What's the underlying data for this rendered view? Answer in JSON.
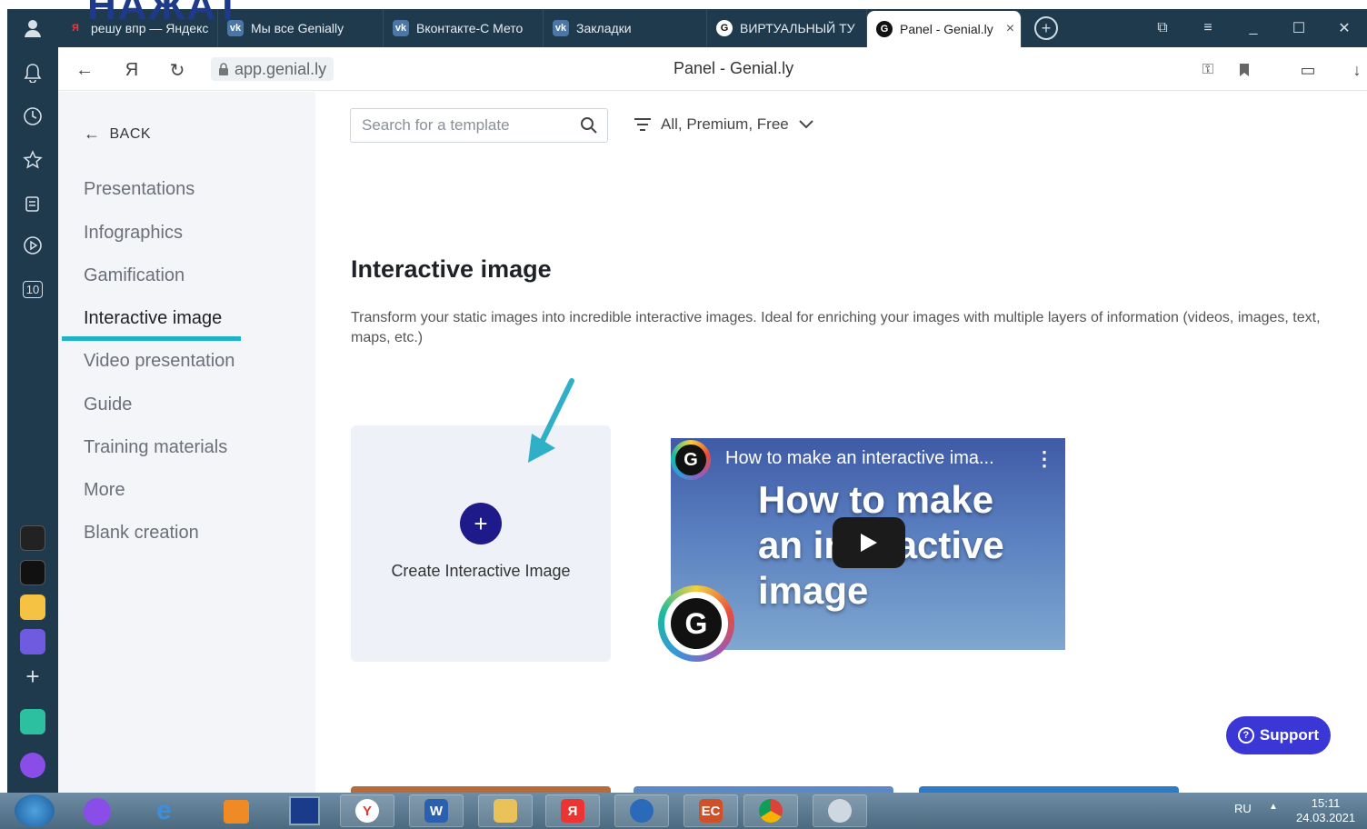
{
  "overlay": {
    "text": "НАЖАТ"
  },
  "tabs": [
    {
      "label": "решу впр — Яндекс",
      "favicon": "Я",
      "color": "#ff3333"
    },
    {
      "label": "Мы все Genially",
      "favicon": "vk",
      "color": "#4a76a8"
    },
    {
      "label": "Вконтакте-С Мето",
      "favicon": "vk",
      "color": "#4a76a8"
    },
    {
      "label": "Закладки",
      "favicon": "vk",
      "color": "#4a76a8"
    },
    {
      "label": "ВИРТУАЛЬНЫЙ ТУ",
      "favicon": "G",
      "color": "#ffffff"
    },
    {
      "label": "Panel - Genial.ly",
      "favicon": "G",
      "color": "#111111"
    }
  ],
  "address": {
    "url": "app.genial.ly",
    "page_title": "Panel - Genial.ly"
  },
  "sidebar": {
    "back_label": "BACK",
    "items": [
      {
        "label": "Presentations"
      },
      {
        "label": "Infographics"
      },
      {
        "label": "Gamification"
      },
      {
        "label": "Interactive image"
      },
      {
        "label": "Video presentation"
      },
      {
        "label": "Guide"
      },
      {
        "label": "Training materials"
      },
      {
        "label": "More"
      },
      {
        "label": "Blank creation"
      }
    ],
    "active_index": 3
  },
  "search": {
    "placeholder": "Search for a template"
  },
  "filter": {
    "label": "All, Premium, Free"
  },
  "main": {
    "heading": "Interactive image",
    "description": "Transform your static images into incredible interactive images. Ideal for enriching your images with multiple layers of information (videos, images, text, maps, etc.)",
    "create_card_label": "Create Interactive Image",
    "video": {
      "title": "How to make an interactive ima...",
      "big_line1": "How to make",
      "big_line2": "an interactive",
      "big_line3": "image"
    },
    "support_label": "Support"
  },
  "rail": {
    "counter": "10"
  },
  "taskbar": {
    "lang": "RU",
    "time": "15:11",
    "date": "24.03.2021"
  },
  "colors": {
    "accent": "#1fb3c8",
    "plus": "#1f1a8a",
    "support": "#3b37d6",
    "chrome": "#1f3a4d"
  }
}
